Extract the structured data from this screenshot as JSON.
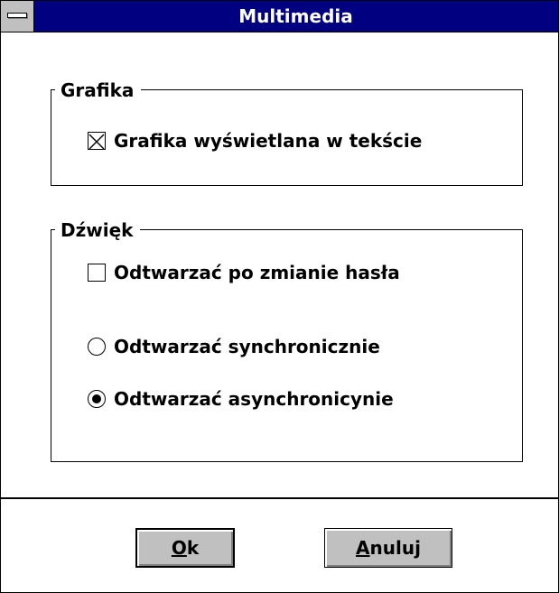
{
  "window": {
    "title": "Multimedia"
  },
  "grafika": {
    "label": "Grafika",
    "checkbox_label": "Grafika wyświetlana w tekście",
    "checked": true
  },
  "dzwiek": {
    "label": "Dźwięk",
    "checkbox_label": "Odtwarzać po zmianie hasła",
    "checked": false,
    "radio_sync": {
      "label": "Odtwarzać synchronicznie",
      "selected": false
    },
    "radio_async": {
      "label": "Odtwarzać asynchronicynie",
      "selected": true
    }
  },
  "buttons": {
    "ok": {
      "mnemonic": "O",
      "rest": "k"
    },
    "cancel": {
      "mnemonic": "A",
      "rest": "nuluj"
    }
  },
  "colors": {
    "titlebar": "#000080",
    "button_face": "#c0c0c0",
    "window": "#ffffff"
  }
}
